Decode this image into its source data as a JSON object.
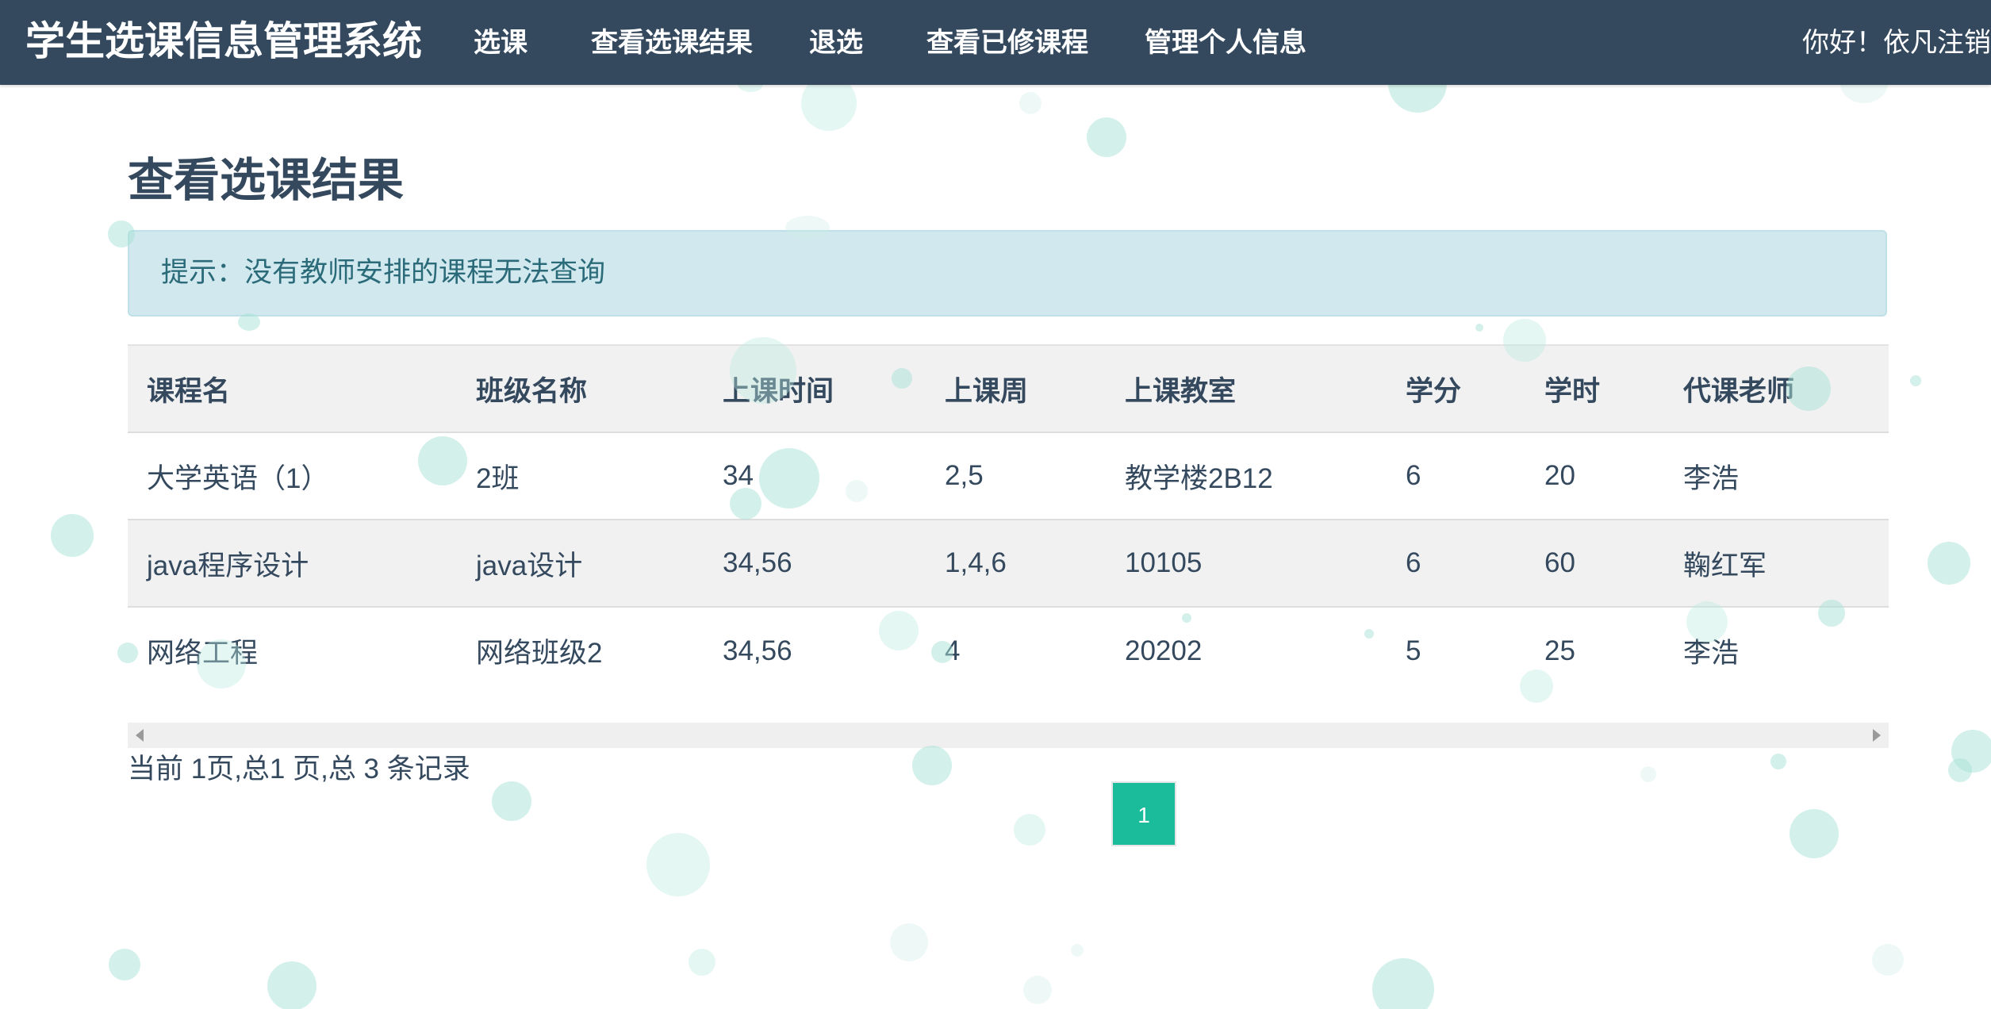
{
  "navbar": {
    "brand": "学生选课信息管理系统",
    "items": [
      "选课",
      "查看选课结果",
      "退选",
      "查看已修课程",
      "管理个人信息"
    ],
    "greeting": "你好！依凡",
    "logout": "注销"
  },
  "page": {
    "title": "查看选课结果",
    "alert": "提示：没有教师安排的课程无法查询"
  },
  "table": {
    "headers": [
      "课程名",
      "班级名称",
      "上课时间",
      "上课周",
      "上课教室",
      "学分",
      "学时",
      "代课老师"
    ],
    "rows": [
      [
        "大学英语（1）",
        "2班",
        "34",
        "2,5",
        "教学楼2B12",
        "6",
        "20",
        "李浩"
      ],
      [
        "java程序设计",
        "java设计",
        "34,56",
        "1,4,6",
        "10105",
        "6",
        "60",
        "鞠红军"
      ],
      [
        "网络工程",
        "网络班级2",
        "34,56",
        "4",
        "20202",
        "5",
        "25",
        "李浩"
      ]
    ]
  },
  "pagination": {
    "info": "当前 1页,总1 页,总 3 条记录",
    "current_page": "1"
  },
  "colors": {
    "navbar": "#34495e",
    "accent": "#1abc9c",
    "alert_bg": "#d1e9ee",
    "bubble": "#a8e2d6"
  }
}
